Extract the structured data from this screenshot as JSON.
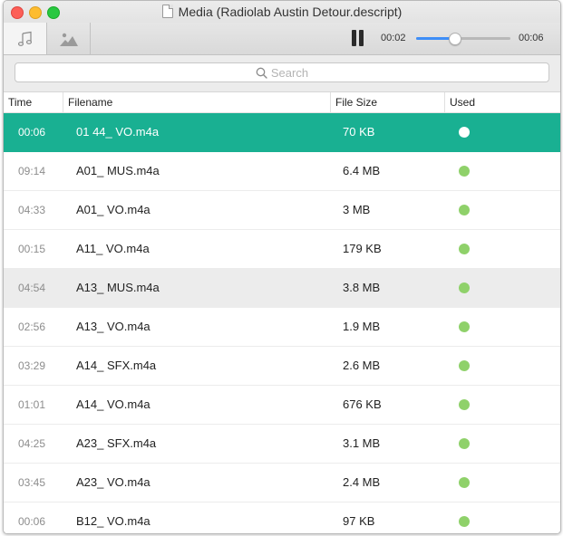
{
  "window": {
    "title": "Media (Radiolab Austin Detour.descript)",
    "traffic_lights": {
      "close": "#fc5f57",
      "minimize": "#fdbc2e",
      "maximize": "#28c840"
    }
  },
  "toolbar": {
    "tabs": [
      {
        "icon": "music-note-icon",
        "active": true
      },
      {
        "icon": "image-icon",
        "active": false
      }
    ],
    "playback": {
      "state_icon": "pause-icon",
      "current_time": "00:02",
      "total_time": "00:06",
      "progress": 0.4
    }
  },
  "search": {
    "placeholder": "Search",
    "icon": "search-icon"
  },
  "table": {
    "columns": [
      "Time",
      "Filename",
      "File Size",
      "Used"
    ],
    "rows": [
      {
        "time": "00:06",
        "filename": "01 44_ VO.m4a",
        "size": "70 KB",
        "used": true,
        "selected": true
      },
      {
        "time": "09:14",
        "filename": "A01_ MUS.m4a",
        "size": "6.4 MB",
        "used": true
      },
      {
        "time": "04:33",
        "filename": "A01_ VO.m4a",
        "size": "3 MB",
        "used": true
      },
      {
        "time": "00:15",
        "filename": "A11_ VO.m4a",
        "size": "179 KB",
        "used": true
      },
      {
        "time": "04:54",
        "filename": "A13_ MUS.m4a",
        "size": "3.8 MB",
        "used": true,
        "hover": true
      },
      {
        "time": "02:56",
        "filename": "A13_ VO.m4a",
        "size": "1.9 MB",
        "used": true
      },
      {
        "time": "03:29",
        "filename": "A14_ SFX.m4a",
        "size": "2.6 MB",
        "used": true
      },
      {
        "time": "01:01",
        "filename": "A14_ VO.m4a",
        "size": "676 KB",
        "used": true
      },
      {
        "time": "04:25",
        "filename": "A23_ SFX.m4a",
        "size": "3.1 MB",
        "used": true
      },
      {
        "time": "03:45",
        "filename": "A23_ VO.m4a",
        "size": "2.4 MB",
        "used": true
      },
      {
        "time": "00:06",
        "filename": "B12_ VO.m4a",
        "size": "97 KB",
        "used": true
      }
    ]
  },
  "colors": {
    "selected_row": "#19b092",
    "used_dot": "#8fd16a",
    "slider_fill": "#3e8ef7"
  }
}
